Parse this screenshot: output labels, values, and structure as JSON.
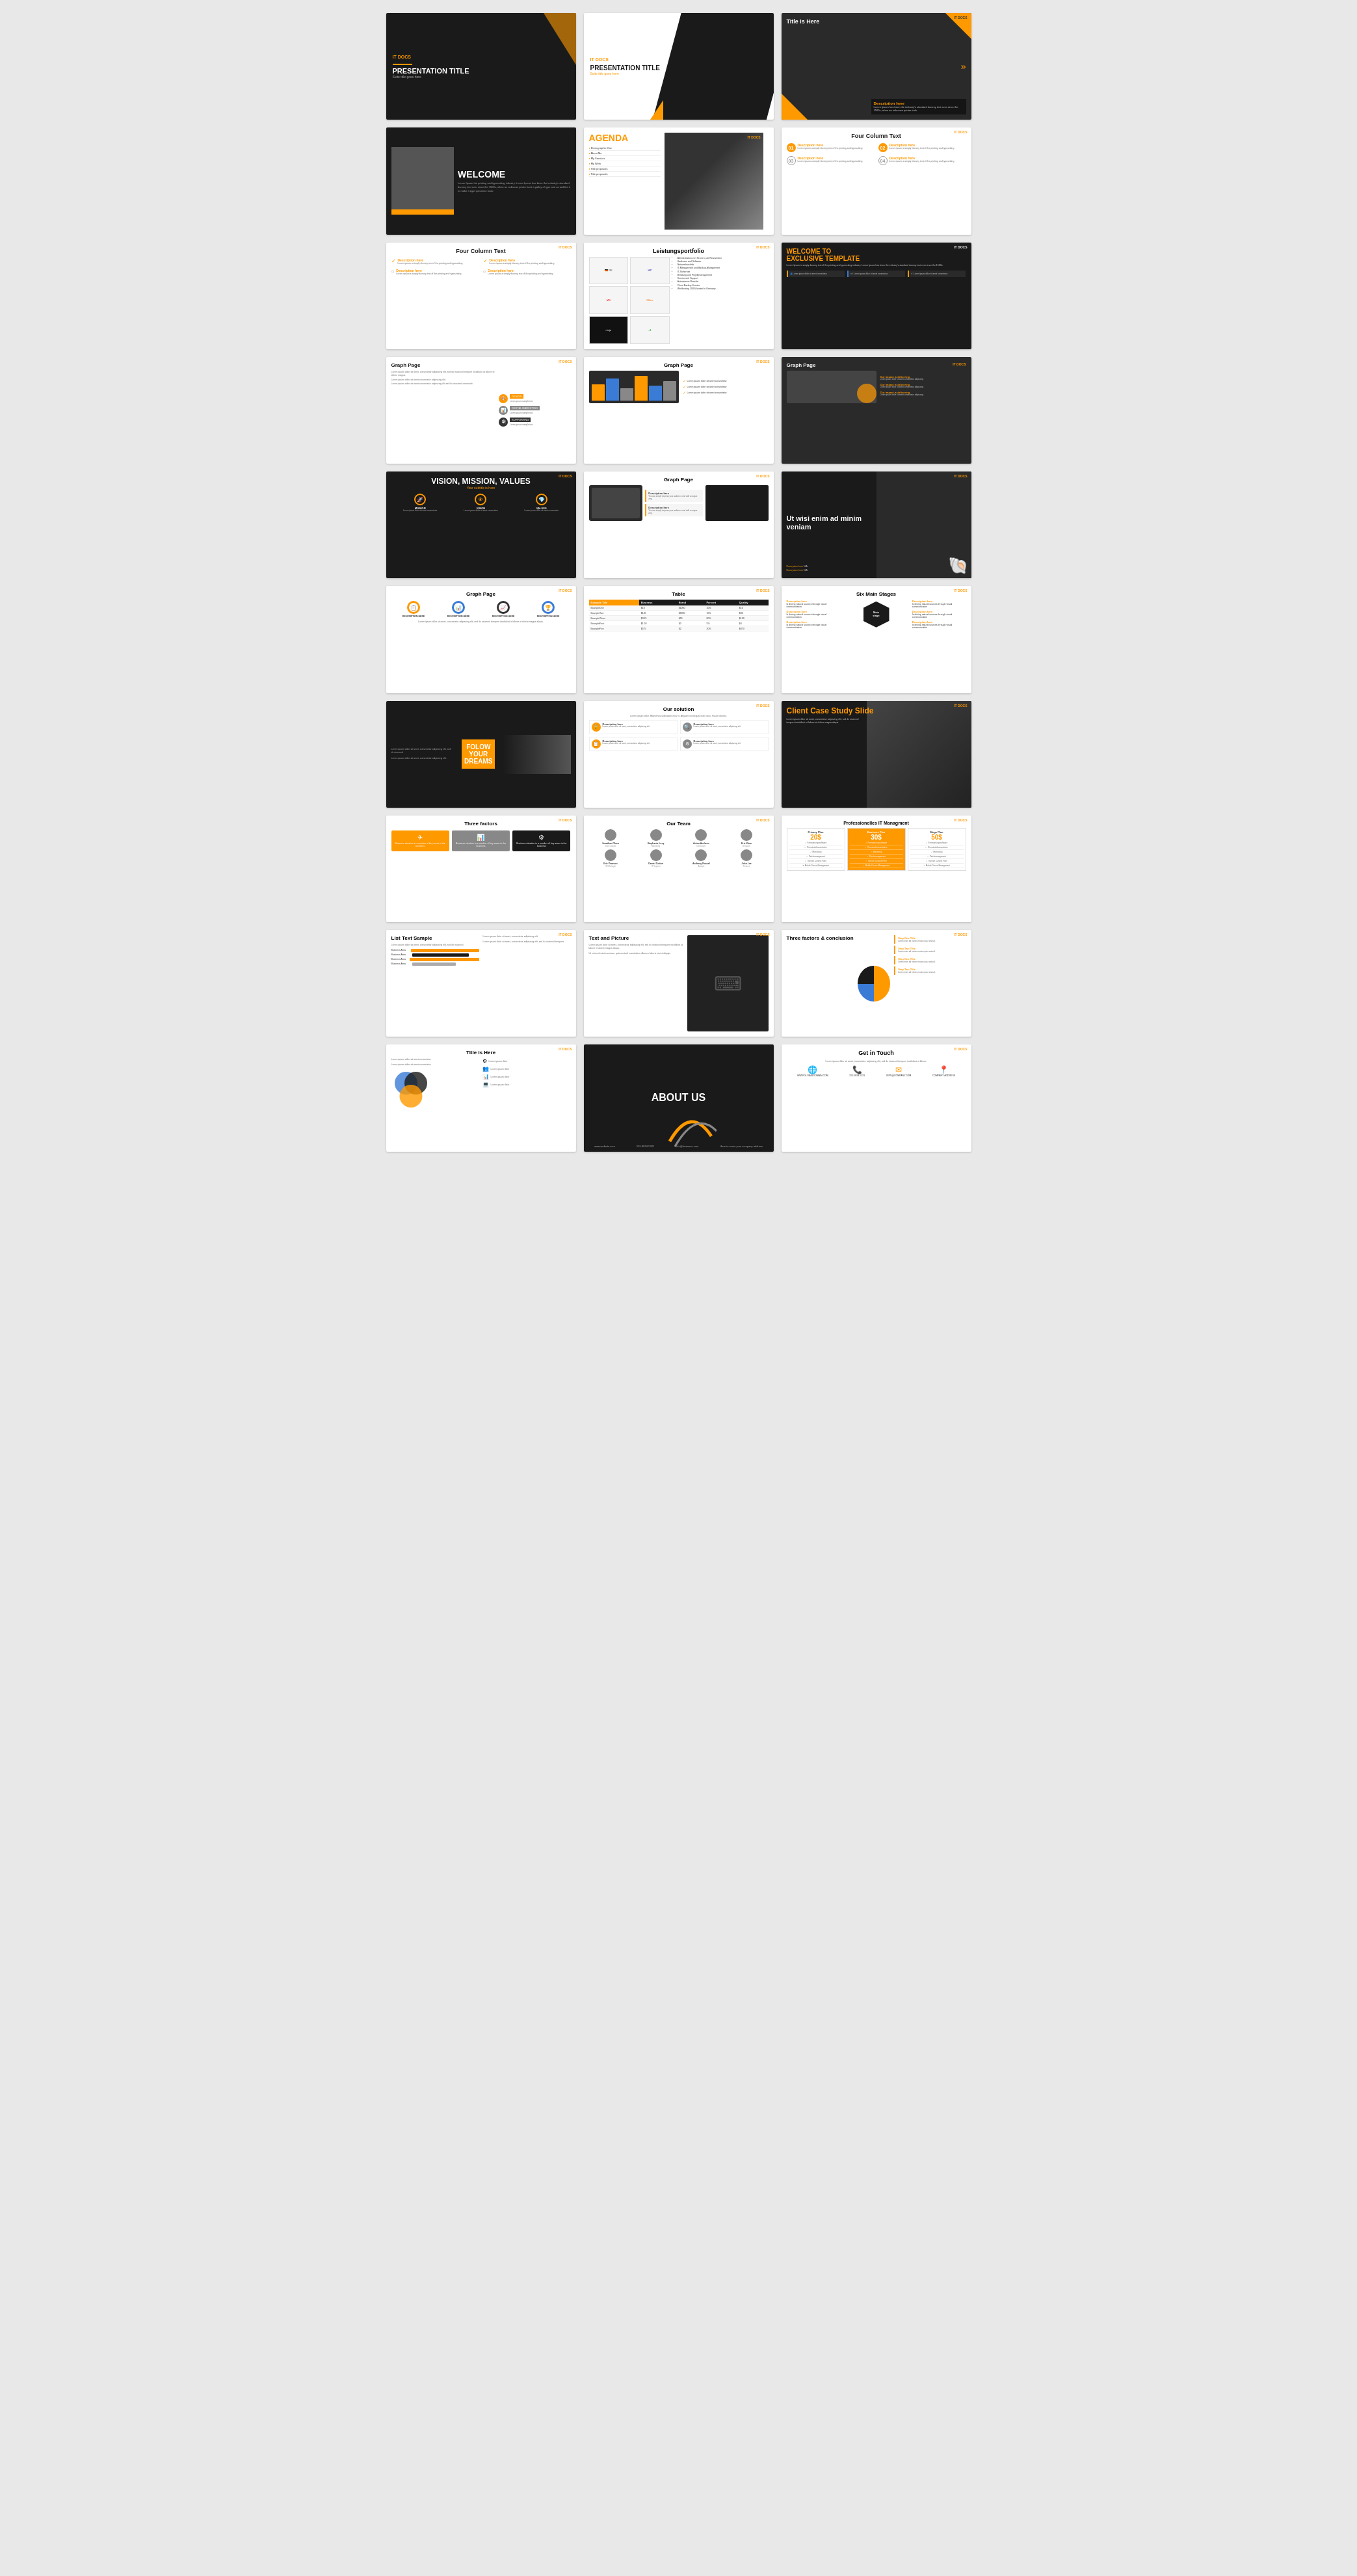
{
  "slides": [
    {
      "id": 1,
      "type": "presentation-title-dark",
      "logo": "IT DOCS",
      "title": "PRESENTATION TITLE",
      "subtitle": "Suite title goes here"
    },
    {
      "id": 2,
      "type": "presentation-title-light",
      "logo": "IT DOCS",
      "title": "PRESENTATION TITLE",
      "subtitle": "Suite title goes here"
    },
    {
      "id": 3,
      "type": "title-here",
      "logo": "IT DOCS",
      "title": "Title is Here",
      "description_title": "Description here",
      "description": "Lorem Ipsum has been the industry's standard dummy text ever since the 1500s, when an unknown printer took"
    },
    {
      "id": 4,
      "type": "welcome",
      "logo": "IT DOCS",
      "title": "WELCOME",
      "body": "Lorem Ipsum the printing and typesetting industry. Lorem Ipsum has been the industry's standard dummy text ever since the 1500s, when an unknown printer took a galley of type and scrambled it to make a type specimen book."
    },
    {
      "id": 5,
      "type": "agenda",
      "logo": "IT DOCS",
      "title": "AGENDA",
      "items": [
        "Demographic One",
        "About Me",
        "My Services",
        "My Work",
        "Title proposals",
        "Title proposals"
      ]
    },
    {
      "id": 6,
      "type": "four-column-text-numbered",
      "logo": "IT DOCS",
      "title": "Four Column Text",
      "items": [
        {
          "num": "01",
          "label": "Description here",
          "text": "Lorem ipsum a simply dummy text of the printing and typesetting"
        },
        {
          "num": "02",
          "label": "Description here",
          "text": "Lorem ipsum a simply dummy text of the printing and typesetting"
        },
        {
          "num": "03",
          "label": "Description here",
          "text": "Lorem ipsum a simply dummy text of the printing and typesetting"
        },
        {
          "num": "04",
          "label": "Description here",
          "text": "Lorem ipsum a simply dummy text of the printing and typesetting"
        }
      ]
    },
    {
      "id": 7,
      "type": "four-column-text-checks",
      "logo": "IT DOCS",
      "title": "Four Column Text",
      "items": [
        {
          "label": "Description here",
          "text": "Lorem ipsum a simply dummy text of the printing and typesetting"
        },
        {
          "label": "Description here",
          "text": "Lorem ipsum a simply dummy text of the printing and typesetting"
        },
        {
          "label": "Description here",
          "text": "Lorem ipsum a simply dummy text of the printing and typesetting"
        },
        {
          "label": "Description here",
          "text": "Lorem ipsum a simply dummy text of the printing and typesetting"
        }
      ]
    },
    {
      "id": 8,
      "type": "leistungsportfolio",
      "logo": "IT DOCS",
      "title": "Leistungsportfolio",
      "logos": [
        "DE",
        "HP",
        "Microsoft",
        "Office",
        "Ninja"
      ],
      "list": [
        "Administration von Servern und Netzwerken",
        "Hardware and Software",
        "Netzwerktechnik",
        "IT-Management und Backup-Management",
        "IT-Sicherheit",
        "Beratung und Projektmanagement",
        "Service und Support vor Ort und per Fernwartung",
        "Autorisierter Reseller und Partner Acronis, DocuWare, Nero, VMWare",
        "Cloud Backup Service möglich",
        "Werbung, Webhosting und Webserver 100% hosted in Germany"
      ]
    },
    {
      "id": 9,
      "type": "welcome-exclusive",
      "logo": "IT DOCS",
      "title": "WELCOME TO",
      "title2": "Exclusive Template",
      "body": "Lorem Ipsum is simply dummy text of the printing and typesetting industry. Lorem Ipsum has been the industry's standard dummy text ever since the 1500s.",
      "cards": [
        {
          "text": "Lorem ipsum dolor sit amet consectetur adipiscing elit sed do eiusmod"
        },
        {
          "text": "Lorem ipsum dolor sit amet consectetur adipiscing elit sed do eiusmod"
        },
        {
          "text": "Lorem ipsum dolor sit amet consectetur adipiscing elit sed do eiusmod"
        }
      ]
    },
    {
      "id": 10,
      "type": "graph-page-1",
      "logo": "IT DOCS",
      "title": "Graph Page",
      "items": [
        {
          "label": "DESIGN",
          "icon": "🎨"
        },
        {
          "label": "DIGITAL MARKETING",
          "icon": "📊"
        },
        {
          "label": "SUPPORTING",
          "icon": "🛠"
        }
      ]
    },
    {
      "id": 11,
      "type": "graph-page-2",
      "logo": "IT DOCS",
      "title": "Graph Page",
      "bars": [
        60,
        80,
        45,
        90,
        55,
        70
      ],
      "checks": [
        "Lorem ipsum dolor sit amet",
        "Lorem ipsum dolor sit amet",
        "Lorem ipsum dolor sit amet"
      ]
    },
    {
      "id": 12,
      "type": "graph-page-3",
      "logo": "IT DOCS",
      "title": "Graph Page",
      "items": [
        {
          "title": "Our impact is delivering",
          "text": "Lorem ipsum dolor sit amet"
        },
        {
          "title": "Our impact is delivering",
          "text": "Lorem ipsum dolor sit amet"
        },
        {
          "title": "Our impact is delivering",
          "text": "Lorem ipsum dolor sit amet"
        }
      ]
    },
    {
      "id": 13,
      "type": "vision-mission-values",
      "logo": "IT DOCS",
      "title": "VISION, MISSION, VALUES",
      "subtitle": "Your subtitle is here",
      "items": [
        {
          "icon": "🚀",
          "label": "MISSION",
          "text": "Lorem ipsum dolor sit amet consectetur"
        },
        {
          "icon": "👁",
          "label": "VISION",
          "text": "Lorem ipsum dolor sit amet consectetur"
        },
        {
          "icon": "💎",
          "label": "VALUES",
          "text": "Lorem ipsum dolor sit amet consectetur"
        }
      ]
    },
    {
      "id": 14,
      "type": "graph-page-4",
      "logo": "IT DOCS",
      "title": "Graph Page",
      "desc_blocks": [
        {
          "title": "Description here",
          "text": "You can simply impress your audience and add a unique zing and appeal to your Presentations."
        },
        {
          "title": "Description here",
          "text": "You can simply impress your audience and add a unique zing and appeal to your Presentations."
        }
      ]
    },
    {
      "id": 15,
      "type": "ut-wisi",
      "logo": "IT DOCS",
      "title": "Ut wisi enim ad minim veniam",
      "desc_items": [
        {
          "label": "Description here",
          "text": "N/A"
        },
        {
          "label": "Description here",
          "text": "N/A"
        }
      ]
    },
    {
      "id": 16,
      "type": "graph-circles",
      "logo": "IT DOCS",
      "title": "Graph Page",
      "circles": [
        {
          "icon": "📋",
          "label": "DESCRIPTION HERE"
        },
        {
          "icon": "📊",
          "label": "DESCRIPTION HERE"
        },
        {
          "icon": "📈",
          "label": "DESCRIPTION HERE"
        },
        {
          "icon": "🏆",
          "label": "DESCRIPTION HERE"
        }
      ],
      "body": "Lorem ipsum dolor sit amet, consectetur adipiscing elit, sed do eiusmod tempore incididunt ut labore et dolore magna aliqua."
    },
    {
      "id": 17,
      "type": "table",
      "logo": "IT DOCS",
      "title": "Table",
      "headers": [
        "Example Title",
        "Business",
        "Brand",
        "Percent",
        "Quality"
      ],
      "rows": [
        [
          "ExampleOne",
          "$10",
          "$1000",
          "10%",
          "$10"
        ],
        [
          "ExampleTwo",
          "$125",
          "$5000",
          "15%",
          "$80"
        ],
        [
          "ExampleThree",
          "$3.25",
          "$50",
          "80%",
          "$130"
        ],
        [
          "ExampleFour",
          "$1.50",
          "$3",
          "5%",
          "$4"
        ],
        [
          "ExampleFive",
          "$575",
          "$2",
          "20%",
          "$870"
        ]
      ]
    },
    {
      "id": 18,
      "type": "six-main-stages",
      "logo": "IT DOCS",
      "title": "Six Main Stages",
      "center": {
        "label": "Main stage",
        "sub": "Incorporating art\nthrough visuals"
      },
      "items": [
        {
          "title": "Description here",
          "text": "Is driving natural sources through visual communication"
        },
        {
          "title": "Description here",
          "text": "Is driving natural sources through visual communication"
        },
        {
          "title": "Description here",
          "text": "Is driving natural sources through visual communication"
        },
        {
          "title": "Description here",
          "text": "Is driving natural sources through visual communication"
        },
        {
          "title": "Description here",
          "text": "Is driving natural sources through visual communication"
        },
        {
          "title": "Description here",
          "text": "Is driving natural sources through visual communication"
        }
      ]
    },
    {
      "id": 19,
      "type": "follow-dreams",
      "logo": "IT DOCS",
      "title": "FOLOW YOUR DREAMS",
      "body_left": "Lorem ipsum dolor sit amet, consectetur adipiscing elit, sed do eiusmod."
    },
    {
      "id": 20,
      "type": "our-solution",
      "logo": "IT DOCS",
      "title": "Our solution",
      "intro": "Lorem ipsum dolor. Maecenas sollicitudin eros et. Aliquam consequat dolor arcu. Fusce lobortis. Lorem ipsum dolor. Maecenas sollicitudin eros et. Aliquam consequat dolor arcu. Fusce lobortis.",
      "items": [
        {
          "icon": "🔒",
          "title": "Description here",
          "text": "Lorem ipsum dolor sit amet, consectetur adipiscing elit."
        },
        {
          "icon": "🔍",
          "title": "Description here",
          "text": "Lorem ipsum dolor sit amet, consectetur adipiscing elit."
        },
        {
          "icon": "📋",
          "title": "Description here",
          "text": "Lorem ipsum dolor sit amet, consectetur adipiscing elit."
        },
        {
          "icon": "⚙",
          "title": "Description here",
          "text": "Lorem ipsum dolor sit amet, consectetur adipiscing elit."
        }
      ]
    },
    {
      "id": 21,
      "type": "client-case",
      "logo": "IT DOCS",
      "title": "Client Case Study Slide",
      "body": "Lorem ipsum dolor sit amet, consectetur adipiscing elit, sed do eiusmod tempore incididunt ut labore et dolore magna aliqua."
    },
    {
      "id": 22,
      "type": "three-factors",
      "logo": "IT DOCS",
      "title": "Three factors",
      "items": [
        {
          "icon": "✈",
          "text": "Business situation in a number of key areas in the business and provides a detailed analysis."
        },
        {
          "icon": "📊",
          "text": "Business situation in a number of key areas in the business and provides a detailed analysis."
        },
        {
          "icon": "⚙",
          "text": "Business situation in a number of key areas in the business and provides a detailed analysis."
        }
      ]
    },
    {
      "id": 23,
      "type": "our-team",
      "logo": "IT DOCS",
      "title": "Our Team",
      "members": [
        {
          "name": "Jonathan Olsen",
          "role": "Team Leader"
        },
        {
          "name": "Stephanie Levy",
          "role": "Marketing"
        },
        {
          "name": "Anton Andreev",
          "role": "Developer"
        },
        {
          "name": "Eric Khan",
          "role": "Designer"
        },
        {
          "name": "Eric Pearson",
          "role": "HR Manager"
        },
        {
          "name": "Daniel Cotton",
          "role": "IT Support"
        },
        {
          "name": "Anthony Russel",
          "role": "Analyst"
        },
        {
          "name": "John Lee",
          "role": "Finance"
        }
      ]
    },
    {
      "id": 24,
      "type": "pricing",
      "logo": "IT DOCS",
      "title": "Professionelles IT Managment",
      "plans": [
        {
          "name": "Privacy Plan",
          "price": "20$",
          "features": [
            "Fernwartungssoftware",
            "Remotedokumentation",
            "Monitoring",
            "Patchmanagement",
            "Internet Content Filter",
            "Mobile Device Management"
          ]
        },
        {
          "name": "Business Plan",
          "price": "30$",
          "features": [
            "Fernwartungssoftware",
            "Remotedokumentation",
            "Monitoring",
            "Patchmanagement",
            "Internet Content Filter",
            "Mobile Device Management"
          ],
          "featured": true
        },
        {
          "name": "Mega Plan",
          "price": "50$",
          "features": [
            "Fernwartungssoftware",
            "Remotedokumentation",
            "Monitoring",
            "Patchmanagement",
            "Internet Content Filter",
            "Mobile Device Management"
          ]
        }
      ]
    },
    {
      "id": 25,
      "type": "list-text-sample",
      "logo": "IT DOCS",
      "title": "List Text Sample",
      "body": "Lorem ipsum dolor sit amet, consectetur adipiscing elit.",
      "bars": [
        {
          "label": "Business Area",
          "width": 80
        },
        {
          "label": "Business Area",
          "width": 65
        },
        {
          "label": "Business Area",
          "width": 90
        },
        {
          "label": "Business Area",
          "width": 50
        }
      ]
    },
    {
      "id": 26,
      "type": "text-and-picture",
      "logo": "IT DOCS",
      "title": "Text and Picture",
      "body": "Lorem ipsum dolor sit amet, consectetur adipiscing elit, sed do eiusmod tempore incididunt ut labore et dolore magna aliqua. Ut enim ad minim veniam, quis nostrud exercitation ullamco laboris."
    },
    {
      "id": 27,
      "type": "three-factors-conclusion",
      "logo": "IT DOCS",
      "title": "Three factors & conclusion",
      "steps": [
        {
          "title": "Step One Title",
          "text": "Lorem enim ad minim veniam, quis nostrud exercitation ullamco laboris."
        },
        {
          "title": "Step Two Title",
          "text": "Lorem enim ad minim veniam, quis nostrud exercitation ullamco laboris."
        },
        {
          "title": "Step One Title",
          "text": "Lorem enim ad minim veniam, quis nostrud exercitation ullamco laboris."
        },
        {
          "title": "Step Two Title",
          "text": "Lorem enim ad minim veniam, quis nostrud exercitation ullamco laboris."
        }
      ]
    },
    {
      "id": 28,
      "type": "title-circles",
      "logo": "IT DOCS",
      "title": "Title is Here",
      "items": [
        {
          "label": "Lorem ipsum dolor",
          "icon": "⚙"
        },
        {
          "label": "Lorem ipsum dolor",
          "icon": "👥"
        },
        {
          "label": "Lorem ipsum dolor",
          "icon": "📊"
        },
        {
          "label": "Lorem ipsum dolor",
          "icon": "💻"
        }
      ]
    },
    {
      "id": 29,
      "type": "about-us",
      "logo": "IT DOCS",
      "title": "ABOUT US",
      "website": "www.website.com",
      "phone": "555-9834-5321",
      "email": "info@business.com",
      "tagline": "Here to serve your company address"
    },
    {
      "id": 30,
      "type": "get-in-touch",
      "logo": "IT DOCS",
      "title": "Get in Touch",
      "body": "Lorem ipsum dolor sit amet, consectetur adipiscing elit, sed do eiusmod tempore incididunt ut labore.",
      "contacts": [
        {
          "icon": "🌐",
          "text": "WWW.GLOBALDOMAIN.COM"
        },
        {
          "icon": "📞",
          "text": "555-9834-5321"
        },
        {
          "icon": "✉",
          "text": "INFO@COMPANY.COM"
        },
        {
          "icon": "📍",
          "text": "HERE TO SERVE YOUR COMPANY ADDRESS"
        }
      ]
    }
  ]
}
